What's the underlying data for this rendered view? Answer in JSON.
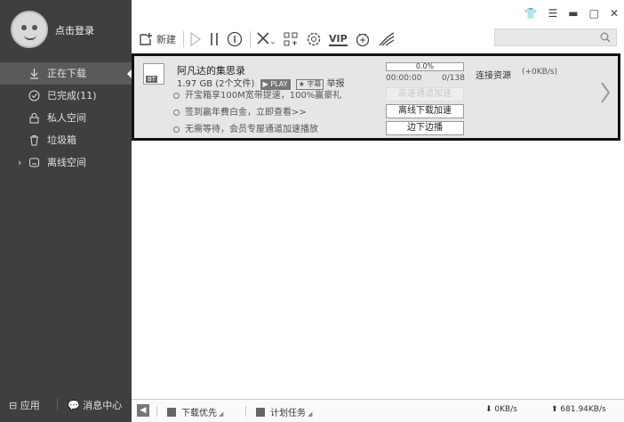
{
  "sidebar": {
    "login_label": "点击登录",
    "items": [
      {
        "label": "正在下载",
        "icon": "download-icon",
        "active": true
      },
      {
        "label": "已完成(11)",
        "icon": "check-circle-icon"
      },
      {
        "label": "私人空间",
        "icon": "lock-icon"
      },
      {
        "label": "垃圾箱",
        "icon": "trash-icon"
      },
      {
        "label": "离线空间",
        "icon": "cloud-icon",
        "expandable": true
      }
    ],
    "bottom": {
      "apps_label": "应用",
      "messages_label": "消息中心"
    }
  },
  "toolbar": {
    "new_label": "新建",
    "icons": [
      "play-icon",
      "pause-icon",
      "info-icon",
      "delete-icon",
      "grid-icon",
      "settings-gear-icon",
      "vip-icon",
      "gift-icon",
      "fast-icon"
    ],
    "vip_label": "VIP"
  },
  "search": {
    "placeholder": ""
  },
  "task": {
    "title": "阿凡达的集思录",
    "size": "1.97 GB",
    "file_count": "(2个文件)",
    "play_tag": "PLAY",
    "subtitle_tag": "字幕",
    "report": "举报",
    "promo1": "开宝箱享100M宽带提速，100%赢豪礼",
    "promo2": "签到赢年費白金，立即查看>>",
    "promo3": "无需等待，会员专屋通道加速播放",
    "progress": "0.0%",
    "progress_value": 0.0,
    "elapsed": "00:00:00",
    "pieces": "0/138",
    "btn_high_speed": "高速通道加速",
    "btn_offline": "离线下载加速",
    "btn_play": "边下边播",
    "connection": "连接资源",
    "speed_bonus": "(+0KB/s)"
  },
  "statusbar": {
    "priority": "下载优先",
    "schedule": "计划任务",
    "down_speed": "0KB/s",
    "up_speed": "681.94KB/s"
  }
}
